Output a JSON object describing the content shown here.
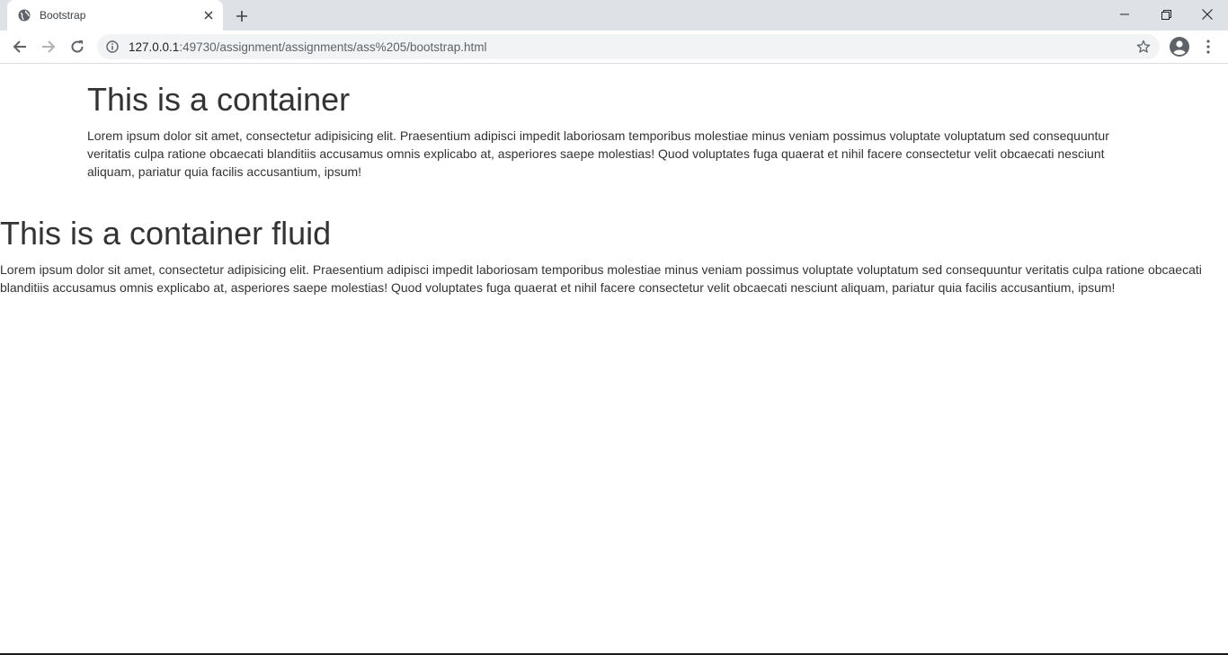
{
  "browser": {
    "tab_title": "Bootstrap",
    "url_host": "127.0.0.1",
    "url_rest": ":49730/assignment/assignments/ass%205/bootstrap.html",
    "icons": {
      "favicon": "globe-icon",
      "close_tab": "close-icon",
      "new_tab": "plus-icon",
      "back": "arrow-left-icon",
      "forward": "arrow-right-icon",
      "reload": "reload-icon",
      "site_info": "info-icon",
      "bookmark": "star-icon",
      "profile": "account-icon",
      "menu": "kebab-menu-icon",
      "minimize": "minimize-icon",
      "restore": "restore-icon",
      "close_window": "close-icon"
    }
  },
  "page": {
    "container": {
      "heading": "This is a container",
      "paragraph": "Lorem ipsum dolor sit amet, consectetur adipisicing elit. Praesentium adipisci impedit laboriosam temporibus molestiae minus veniam possimus voluptate voluptatum sed consequuntur veritatis culpa ratione obcaecati blanditiis accusamus omnis explicabo at, asperiores saepe molestias! Quod voluptates fuga quaerat et nihil facere consectetur velit obcaecati nesciunt aliquam, pariatur quia facilis accusantium, ipsum!"
    },
    "container_fluid": {
      "heading": "This is a container fluid",
      "paragraph": "Lorem ipsum dolor sit amet, consectetur adipisicing elit. Praesentium adipisci impedit laboriosam temporibus molestiae minus veniam possimus voluptate voluptatum sed consequuntur veritatis culpa ratione obcaecati blanditiis accusamus omnis explicabo at, asperiores saepe molestias! Quod voluptates fuga quaerat et nihil facere consectetur velit obcaecati nesciunt aliquam, pariatur quia facilis accusantium, ipsum!"
    },
    "colors": {
      "text": "#333333",
      "tabstrip": "#dee1e6",
      "omnibox": "#f1f3f4"
    }
  }
}
